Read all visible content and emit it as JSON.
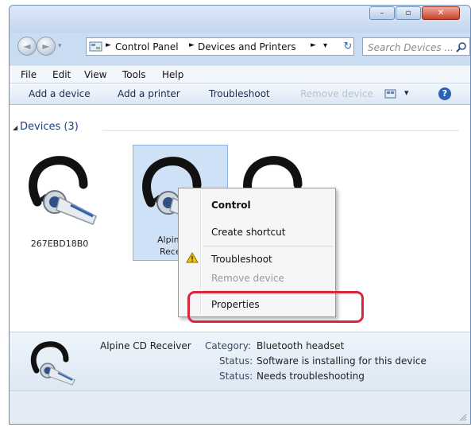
{
  "window": {
    "caption_buttons": [
      "minimize",
      "maximize",
      "close"
    ],
    "close_glyph": "✕",
    "max_glyph": "▫",
    "min_glyph": "–"
  },
  "nav": {
    "back_glyph": "◄",
    "forward_glyph": "►",
    "breadcrumbs": [
      "Control Panel",
      "Devices and Printers"
    ],
    "crumb_separator": "►",
    "dropdown_glyph": "▾",
    "refresh_glyph": "↻",
    "search_placeholder": "Search Devices ...",
    "search_icon": "search-icon"
  },
  "menubar": {
    "items": [
      "File",
      "Edit",
      "View",
      "Tools",
      "Help"
    ]
  },
  "commandbar": {
    "add_device": "Add a device",
    "add_printer": "Add a printer",
    "troubleshoot": "Troubleshoot",
    "remove_device": "Remove device",
    "view_glyph": "▾",
    "help_glyph": "?"
  },
  "devices_group": {
    "header": "Devices (3)",
    "collapse_glyph": "◢",
    "items": [
      {
        "label": "267EBD18B0",
        "selected": false
      },
      {
        "label": "Alpine CD Receiver",
        "visible_label_line1": "Alpine",
        "visible_label_line2": "Receiv",
        "selected": true
      },
      {
        "label": "",
        "selected": false
      }
    ]
  },
  "context_menu": {
    "items": [
      {
        "label": "Control",
        "bold": true,
        "enabled": true
      },
      {
        "label": "Create shortcut",
        "enabled": true
      },
      {
        "label": "Troubleshoot",
        "enabled": true,
        "icon": "warning-icon"
      },
      {
        "label": "Remove device",
        "enabled": false
      },
      {
        "label": "Properties",
        "enabled": true,
        "highlighted": true
      }
    ],
    "highlight_color": "#d9263a"
  },
  "details": {
    "name": "Alpine CD Receiver",
    "category_label": "Category:",
    "category_value": "Bluetooth headset",
    "status1_label": "Status:",
    "status1_value": "Software is installing for this device",
    "status2_label": "Status:",
    "status2_value": "Needs troubleshooting"
  },
  "colors": {
    "accent": "#2a62b7",
    "selection": "#cfe1f7",
    "window_frame": "#c9dcf2"
  }
}
